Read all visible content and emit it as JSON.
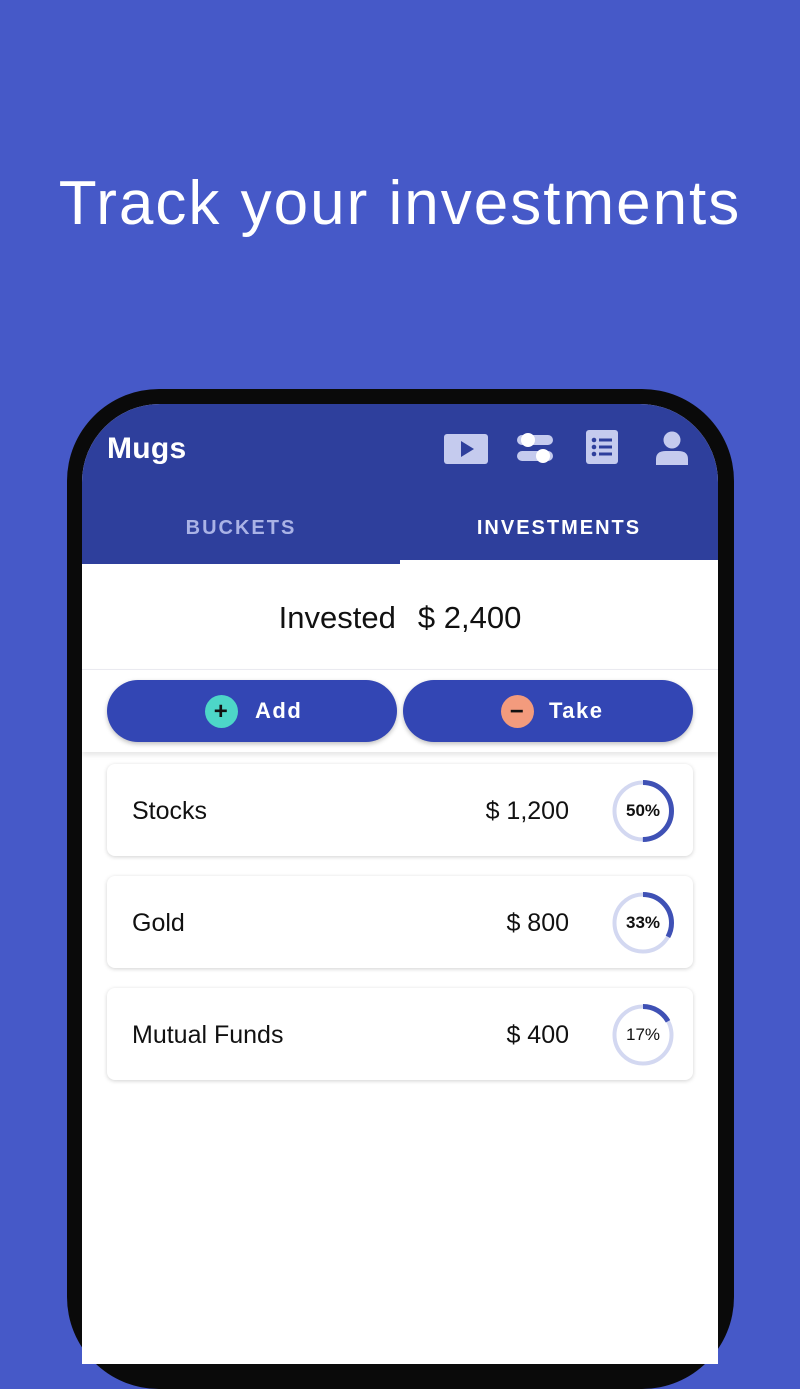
{
  "headline": "Track your investments",
  "app": {
    "title": "Mugs",
    "icons": [
      "video-icon",
      "sliders-icon",
      "list-icon",
      "user-icon"
    ]
  },
  "tabs": [
    {
      "label": "BUCKETS",
      "selected": false
    },
    {
      "label": "INVESTMENTS",
      "selected": true
    }
  ],
  "summary": {
    "label": "Invested",
    "value": "$ 2,400"
  },
  "actions": {
    "add": {
      "label": "Add",
      "icon": "+"
    },
    "take": {
      "label": "Take",
      "icon": "−"
    }
  },
  "investments": [
    {
      "name": "Stocks",
      "amount": "$ 1,200",
      "percent_label": "50%",
      "fraction": 0.5
    },
    {
      "name": "Gold",
      "amount": "$ 800",
      "percent_label": "33%",
      "fraction": 0.33
    },
    {
      "name": "Mutual Funds",
      "amount": "$ 400",
      "percent_label": "17%",
      "fraction": 0.17
    }
  ],
  "colors": {
    "background": "#4659c8",
    "appbar": "#2e3f9c",
    "button": "#3346b4",
    "add_accent": "#4dd6c8",
    "take_accent": "#f39b7d",
    "ring_fill": "#3f51b5",
    "ring_track": "#d3d8f1"
  }
}
